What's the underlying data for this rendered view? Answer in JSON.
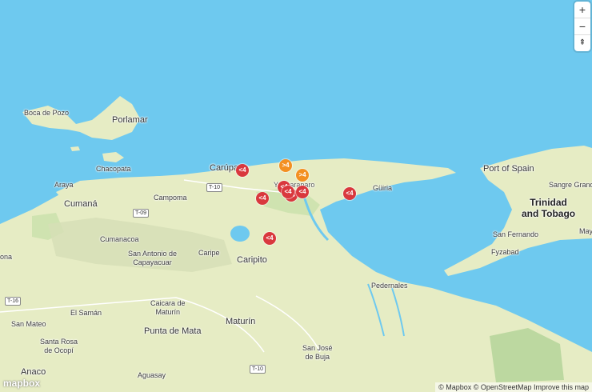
{
  "places": {
    "boca_de_pozo": "Boca de Pozo",
    "porlamar": "Porlamar",
    "chacopata": "Chacopata",
    "carupano": "Carúpano",
    "araya": "Araya",
    "campoma": "Campoma",
    "cumana": "Cumaná",
    "cumanacoa": "Cumanacoa",
    "san_antonio": "San Antonio de\nCapayacuar",
    "caripe": "Caripe",
    "caripito": "Caripito",
    "yaguaraparo": "Yaguaraparo",
    "guiria": "Güiria",
    "port_of_spain": "Port of Spain",
    "sangre_grande": "Sangre Grande",
    "country_tt": "Trinidad\nand Tobago",
    "san_fernando": "San Fernando",
    "fyzabad": "Fyzabad",
    "pedernales": "Pedernales",
    "el_saman": "El Samán",
    "caicara": "Caicara de\nMaturín",
    "san_mateo": "San Mateo",
    "punta_de_mata": "Punta de Mata",
    "maturin": "Maturín",
    "santa_rosa": "Santa Rosa\nde Ocopí",
    "san_jose": "San José\nde Buja",
    "anaco": "Anaco",
    "aguasay": "Aguasay",
    "ona": "ona",
    "may": "May"
  },
  "roads": {
    "t10a": "T-10",
    "t09": "T-09",
    "t16": "T-16",
    "t10b": "T-10"
  },
  "markers": [
    {
      "label": "<4",
      "level": "red"
    },
    {
      "label": ">4",
      "level": "orange"
    },
    {
      "label": ">4",
      "level": "orange"
    },
    {
      "label": "<4",
      "level": "red"
    },
    {
      "label": "<4",
      "level": "red"
    },
    {
      "label": "<4",
      "level": "red"
    },
    {
      "label": "<4",
      "level": "red"
    },
    {
      "label": "<4",
      "level": "red"
    },
    {
      "label": "<4",
      "level": "red"
    },
    {
      "label": "<4",
      "level": "red"
    }
  ],
  "controls": {
    "zoom_in": "+",
    "zoom_out": "−",
    "compass": "⇞"
  },
  "attribution": "© Mapbox © OpenStreetMap  Improve this map",
  "logo": "mapbox",
  "colors": {
    "sea": "#6ec9ef",
    "land": "#e6ecc4",
    "marker_red": "#d9383e",
    "marker_orange": "#f39022"
  }
}
